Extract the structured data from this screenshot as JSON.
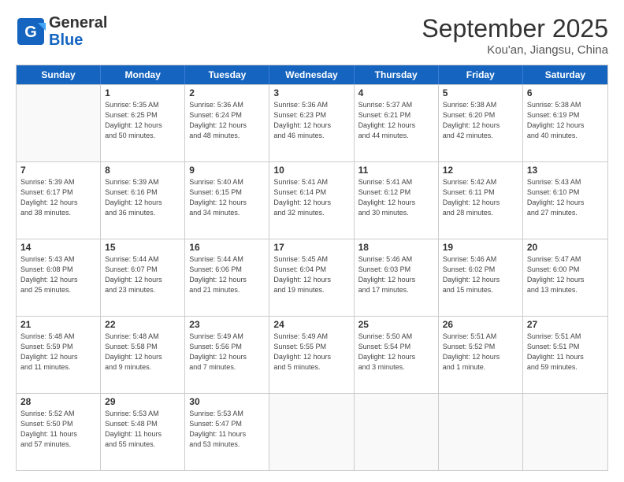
{
  "header": {
    "logo_line1": "General",
    "logo_line2": "Blue",
    "month": "September 2025",
    "location": "Kou'an, Jiangsu, China"
  },
  "weekdays": [
    "Sunday",
    "Monday",
    "Tuesday",
    "Wednesday",
    "Thursday",
    "Friday",
    "Saturday"
  ],
  "weeks": [
    [
      {
        "day": "",
        "info": ""
      },
      {
        "day": "1",
        "info": "Sunrise: 5:35 AM\nSunset: 6:25 PM\nDaylight: 12 hours\nand 50 minutes."
      },
      {
        "day": "2",
        "info": "Sunrise: 5:36 AM\nSunset: 6:24 PM\nDaylight: 12 hours\nand 48 minutes."
      },
      {
        "day": "3",
        "info": "Sunrise: 5:36 AM\nSunset: 6:23 PM\nDaylight: 12 hours\nand 46 minutes."
      },
      {
        "day": "4",
        "info": "Sunrise: 5:37 AM\nSunset: 6:21 PM\nDaylight: 12 hours\nand 44 minutes."
      },
      {
        "day": "5",
        "info": "Sunrise: 5:38 AM\nSunset: 6:20 PM\nDaylight: 12 hours\nand 42 minutes."
      },
      {
        "day": "6",
        "info": "Sunrise: 5:38 AM\nSunset: 6:19 PM\nDaylight: 12 hours\nand 40 minutes."
      }
    ],
    [
      {
        "day": "7",
        "info": "Sunrise: 5:39 AM\nSunset: 6:17 PM\nDaylight: 12 hours\nand 38 minutes."
      },
      {
        "day": "8",
        "info": "Sunrise: 5:39 AM\nSunset: 6:16 PM\nDaylight: 12 hours\nand 36 minutes."
      },
      {
        "day": "9",
        "info": "Sunrise: 5:40 AM\nSunset: 6:15 PM\nDaylight: 12 hours\nand 34 minutes."
      },
      {
        "day": "10",
        "info": "Sunrise: 5:41 AM\nSunset: 6:14 PM\nDaylight: 12 hours\nand 32 minutes."
      },
      {
        "day": "11",
        "info": "Sunrise: 5:41 AM\nSunset: 6:12 PM\nDaylight: 12 hours\nand 30 minutes."
      },
      {
        "day": "12",
        "info": "Sunrise: 5:42 AM\nSunset: 6:11 PM\nDaylight: 12 hours\nand 28 minutes."
      },
      {
        "day": "13",
        "info": "Sunrise: 5:43 AM\nSunset: 6:10 PM\nDaylight: 12 hours\nand 27 minutes."
      }
    ],
    [
      {
        "day": "14",
        "info": "Sunrise: 5:43 AM\nSunset: 6:08 PM\nDaylight: 12 hours\nand 25 minutes."
      },
      {
        "day": "15",
        "info": "Sunrise: 5:44 AM\nSunset: 6:07 PM\nDaylight: 12 hours\nand 23 minutes."
      },
      {
        "day": "16",
        "info": "Sunrise: 5:44 AM\nSunset: 6:06 PM\nDaylight: 12 hours\nand 21 minutes."
      },
      {
        "day": "17",
        "info": "Sunrise: 5:45 AM\nSunset: 6:04 PM\nDaylight: 12 hours\nand 19 minutes."
      },
      {
        "day": "18",
        "info": "Sunrise: 5:46 AM\nSunset: 6:03 PM\nDaylight: 12 hours\nand 17 minutes."
      },
      {
        "day": "19",
        "info": "Sunrise: 5:46 AM\nSunset: 6:02 PM\nDaylight: 12 hours\nand 15 minutes."
      },
      {
        "day": "20",
        "info": "Sunrise: 5:47 AM\nSunset: 6:00 PM\nDaylight: 12 hours\nand 13 minutes."
      }
    ],
    [
      {
        "day": "21",
        "info": "Sunrise: 5:48 AM\nSunset: 5:59 PM\nDaylight: 12 hours\nand 11 minutes."
      },
      {
        "day": "22",
        "info": "Sunrise: 5:48 AM\nSunset: 5:58 PM\nDaylight: 12 hours\nand 9 minutes."
      },
      {
        "day": "23",
        "info": "Sunrise: 5:49 AM\nSunset: 5:56 PM\nDaylight: 12 hours\nand 7 minutes."
      },
      {
        "day": "24",
        "info": "Sunrise: 5:49 AM\nSunset: 5:55 PM\nDaylight: 12 hours\nand 5 minutes."
      },
      {
        "day": "25",
        "info": "Sunrise: 5:50 AM\nSunset: 5:54 PM\nDaylight: 12 hours\nand 3 minutes."
      },
      {
        "day": "26",
        "info": "Sunrise: 5:51 AM\nSunset: 5:52 PM\nDaylight: 12 hours\nand 1 minute."
      },
      {
        "day": "27",
        "info": "Sunrise: 5:51 AM\nSunset: 5:51 PM\nDaylight: 11 hours\nand 59 minutes."
      }
    ],
    [
      {
        "day": "28",
        "info": "Sunrise: 5:52 AM\nSunset: 5:50 PM\nDaylight: 11 hours\nand 57 minutes."
      },
      {
        "day": "29",
        "info": "Sunrise: 5:53 AM\nSunset: 5:48 PM\nDaylight: 11 hours\nand 55 minutes."
      },
      {
        "day": "30",
        "info": "Sunrise: 5:53 AM\nSunset: 5:47 PM\nDaylight: 11 hours\nand 53 minutes."
      },
      {
        "day": "",
        "info": ""
      },
      {
        "day": "",
        "info": ""
      },
      {
        "day": "",
        "info": ""
      },
      {
        "day": "",
        "info": ""
      }
    ]
  ]
}
